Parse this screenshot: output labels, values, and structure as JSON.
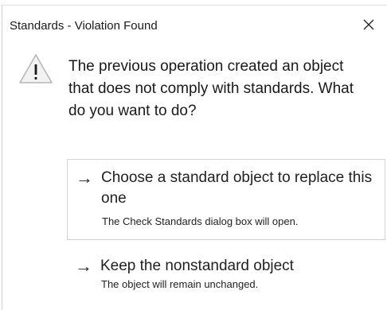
{
  "dialog": {
    "title": "Standards - Violation Found",
    "close_icon": "close-icon",
    "warning_icon": "warning-icon",
    "message": "The previous operation created an object that does not comply with standards. What do you want to do?"
  },
  "options": [
    {
      "arrow": "→",
      "title": "Choose a standard object to replace this one",
      "description": "The Check Standards dialog box will open."
    },
    {
      "arrow": "→",
      "title": "Keep the nonstandard object",
      "description": "The object will remain unchanged."
    }
  ]
}
